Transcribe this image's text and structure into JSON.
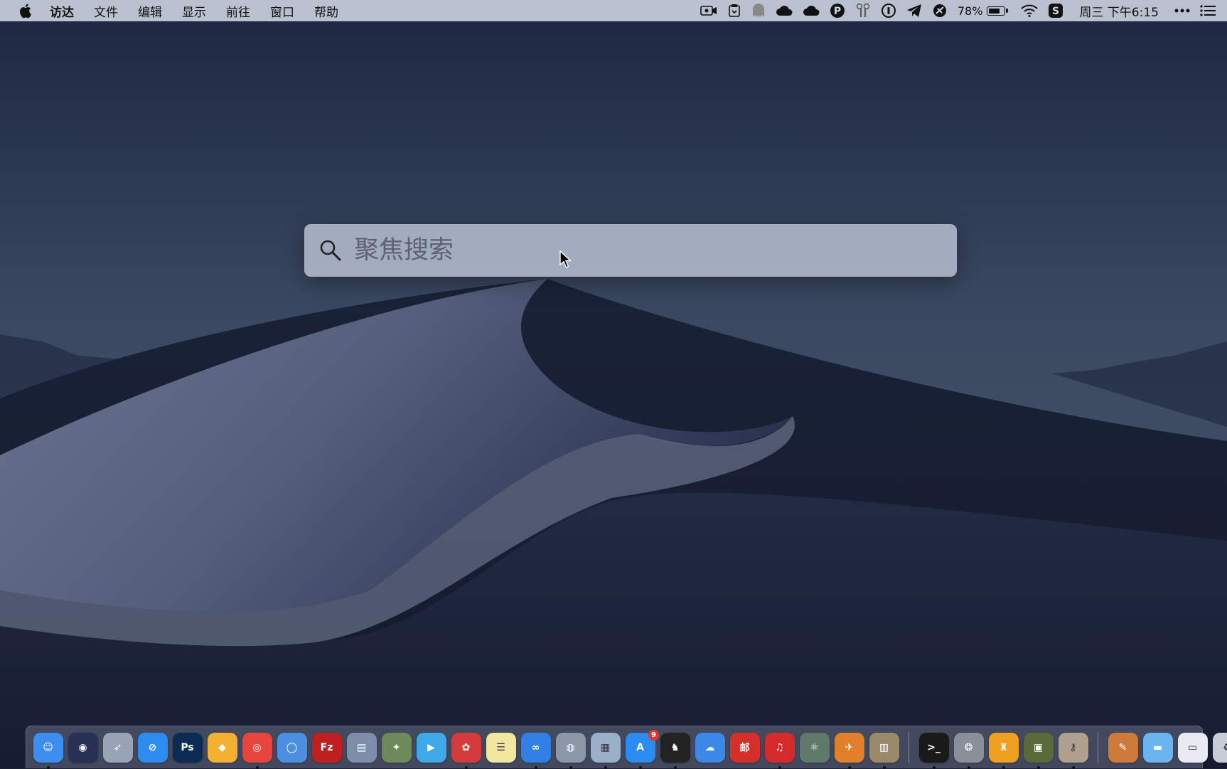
{
  "menubar": {
    "app_name": "访达",
    "menus": [
      "文件",
      "编辑",
      "显示",
      "前往",
      "窗口",
      "帮助"
    ],
    "battery_percent": "78%",
    "battery_level": 0.78,
    "clock": "周三 下午6:15",
    "status_icons": [
      "screen-record-icon",
      "paste-icon",
      "ghost-icon",
      "cloud-icon",
      "cloud-icon",
      "p-icon",
      "airpods-icon",
      "1password-icon",
      "telegram-icon",
      "maps-icon",
      "wifi-icon",
      "sogou-icon",
      "more-icon",
      "notification-center-icon"
    ]
  },
  "spotlight": {
    "placeholder": "聚焦搜索",
    "value": ""
  },
  "dock": {
    "items": [
      {
        "name": "finder",
        "glyph": "☺",
        "color": "#3c8ef0",
        "running": true
      },
      {
        "name": "siri",
        "glyph": "◉",
        "color": "#2a2f55",
        "running": false
      },
      {
        "name": "launchpad",
        "glyph": "➶",
        "color": "#9aa4b5",
        "running": false
      },
      {
        "name": "safari",
        "glyph": "⊘",
        "color": "#2d8cf0",
        "running": false
      },
      {
        "name": "photoshop",
        "glyph": "Ps",
        "color": "#0b2b52",
        "running": false
      },
      {
        "name": "sketch",
        "glyph": "◆",
        "color": "#f4b030",
        "running": false
      },
      {
        "name": "chrome",
        "glyph": "◎",
        "color": "#e8453c",
        "running": true
      },
      {
        "name": "chromium",
        "glyph": "◯",
        "color": "#4a8fe0",
        "running": false
      },
      {
        "name": "filezilla",
        "glyph": "Fz",
        "color": "#bf1f1f",
        "running": false
      },
      {
        "name": "network-utility",
        "glyph": "▤",
        "color": "#7d8fa8",
        "running": false
      },
      {
        "name": "mindnode",
        "glyph": "✦",
        "color": "#6c8a5a",
        "running": false
      },
      {
        "name": "infuse",
        "glyph": "▶",
        "color": "#3ea8e8",
        "running": false
      },
      {
        "name": "paw",
        "glyph": "✿",
        "color": "#d43c3c",
        "running": true
      },
      {
        "name": "notes",
        "glyph": "☰",
        "color": "#f2e7a0",
        "running": false
      },
      {
        "name": "baidu-netdisk",
        "glyph": "∞",
        "color": "#2f7fe6",
        "running": true
      },
      {
        "name": "network-radar",
        "glyph": "◍",
        "color": "#8c97a8",
        "running": true
      },
      {
        "name": "preview",
        "glyph": "▦",
        "color": "#9ab0c8",
        "running": true
      },
      {
        "name": "app-store",
        "glyph": "A",
        "color": "#2a8cf0",
        "running": true,
        "badge": "9"
      },
      {
        "name": "qq",
        "glyph": "♞",
        "color": "#222222",
        "running": true
      },
      {
        "name": "icloud-drive",
        "glyph": "☁",
        "color": "#3b88e8",
        "running": false
      },
      {
        "name": "mail-master",
        "glyph": "邮",
        "color": "#d6302a",
        "running": false
      },
      {
        "name": "netease-music",
        "glyph": "♫",
        "color": "#d42a2a",
        "running": true
      },
      {
        "name": "atom",
        "glyph": "⚛",
        "color": "#5f7a6a",
        "running": false
      },
      {
        "name": "transmit",
        "glyph": "✈",
        "color": "#e0802a",
        "running": true
      },
      {
        "name": "archive-utility",
        "glyph": "▥",
        "color": "#9a8a6a",
        "running": true
      },
      {
        "name": "terminal",
        "glyph": ">_",
        "color": "#1a1a1a",
        "running": true
      },
      {
        "name": "dvd-player",
        "glyph": "❂",
        "color": "#8a8f9a",
        "running": true
      },
      {
        "name": "beer-app",
        "glyph": "♜",
        "color": "#f0a020",
        "running": true
      },
      {
        "name": "image-capture",
        "glyph": "▣",
        "color": "#5a6a3a",
        "running": true
      },
      {
        "name": "keychain",
        "glyph": "⚷",
        "color": "#b0a090",
        "running": true
      },
      {
        "name": "text-editor",
        "glyph": "✎",
        "color": "#d07a3a",
        "running": false
      },
      {
        "name": "folder",
        "glyph": "▬",
        "color": "#6ab4f0",
        "running": false
      },
      {
        "name": "screenshot-stack",
        "glyph": "▭",
        "color": "#e8ecf2",
        "running": false
      },
      {
        "name": "trash",
        "glyph": "♻",
        "color": "#c8ccd4",
        "running": false
      }
    ]
  }
}
